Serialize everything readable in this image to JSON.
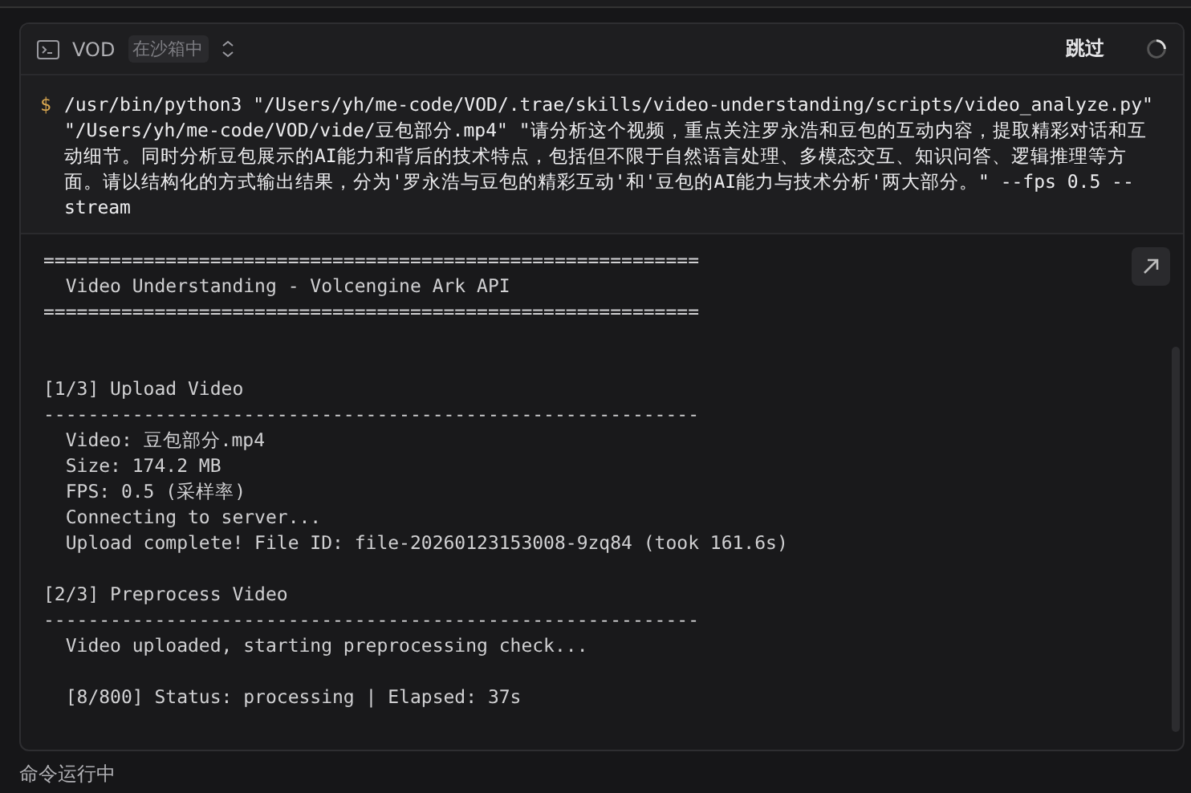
{
  "header": {
    "title": "VOD",
    "badge": "在沙箱中",
    "skip_button": "跳过"
  },
  "command": {
    "prompt": "$",
    "text": "/usr/bin/python3 \"/Users/yh/me-code/VOD/.trae/skills/video-understanding/scripts/video_analyze.py\" \"/Users/yh/me-code/VOD/vide/豆包部分.mp4\" \"请分析这个视频，重点关注罗永浩和豆包的互动内容，提取精彩对话和互动细节。同时分析豆包展示的AI能力和背后的技术特点，包括但不限于自然语言处理、多模态交互、知识问答、逻辑推理等方面。请以结构化的方式输出结果，分为'罗永浩与豆包的精彩互动'和'豆包的AI能力与技术分析'两大部分。\" --fps 0.5 --stream"
  },
  "output_sections": [
    {
      "kind": "banner",
      "lines": [
        "===========================================================",
        "  Video Understanding - Volcengine Ark API",
        "==========================================================="
      ]
    },
    {
      "kind": "block",
      "lines": [
        "[1/3] Upload Video",
        "-----------------------------------------------------------",
        "  Video: 豆包部分.mp4",
        "  Size: 174.2 MB",
        "  FPS: 0.5 (采样率)",
        "  Connecting to server...",
        "  Upload complete! File ID: file-20260123153008-9zq84 (took 161.6s)"
      ]
    },
    {
      "kind": "block",
      "lines": [
        "[2/3] Preprocess Video",
        "-----------------------------------------------------------",
        "  Video uploaded, starting preprocessing check..."
      ]
    },
    {
      "kind": "block",
      "lines": [
        "  [8/800] Status: processing | Elapsed: 37s"
      ]
    }
  ],
  "status_text": "命令运行中"
}
